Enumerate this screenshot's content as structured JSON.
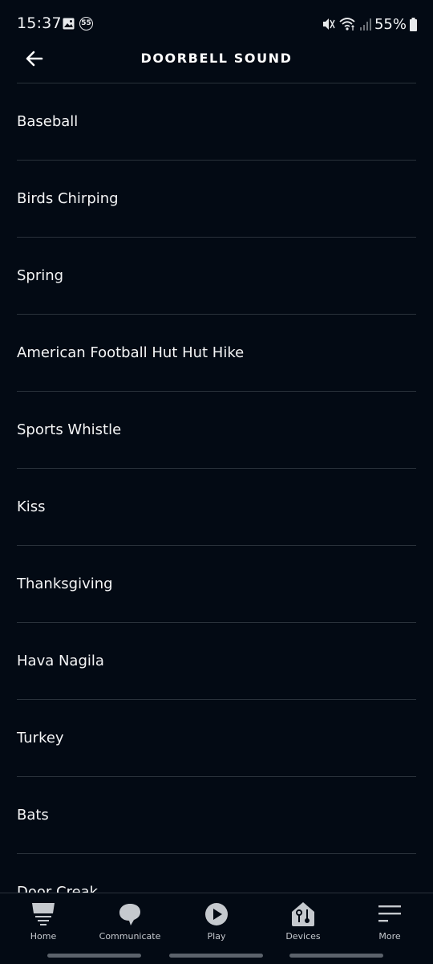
{
  "status_bar": {
    "time": "15:37",
    "notification_badge": "55",
    "battery": "55%",
    "icons": [
      "gallery-icon",
      "notification-count-icon",
      "mute-icon",
      "wifi-icon",
      "signal-icon",
      "battery-icon"
    ]
  },
  "header": {
    "title": "DOORBELL SOUND",
    "back_icon": "arrow-left-icon"
  },
  "sounds": [
    {
      "label": "Baseball"
    },
    {
      "label": "Birds Chirping"
    },
    {
      "label": "Spring"
    },
    {
      "label": "American Football Hut Hut Hike"
    },
    {
      "label": "Sports Whistle"
    },
    {
      "label": "Kiss"
    },
    {
      "label": "Thanksgiving"
    },
    {
      "label": "Hava Nagila"
    },
    {
      "label": "Turkey"
    },
    {
      "label": "Bats"
    },
    {
      "label": "Door Creak"
    }
  ],
  "bottom_nav": {
    "items": [
      {
        "label": "Home",
        "icon": "home-icon"
      },
      {
        "label": "Communicate",
        "icon": "speech-bubble-icon"
      },
      {
        "label": "Play",
        "icon": "play-icon"
      },
      {
        "label": "Devices",
        "icon": "devices-house-icon"
      },
      {
        "label": "More",
        "icon": "menu-icon"
      }
    ]
  },
  "colors": {
    "background": "#030a14",
    "divider": "#2a323b",
    "nav_icon": "#c5c9ce"
  }
}
